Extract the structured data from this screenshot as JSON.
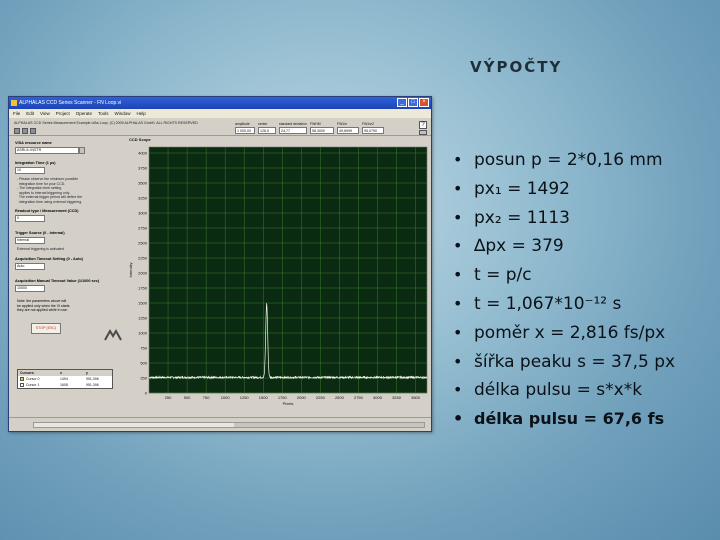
{
  "slide": {
    "title": "VÝPOČTY"
  },
  "window": {
    "title": "ALPHALAS CCD Series Scanner - FN Loop.vi",
    "menu": [
      "File",
      "Edit",
      "View",
      "Project",
      "Operate",
      "Tools",
      "Window",
      "Help"
    ],
    "copyright": "ALPHALAS CCD Series Measurement Example ofAs Loop. (C) 2009 ALPHALAS GmbH. ALL RIGHTS RESERVED",
    "readouts": [
      {
        "label": "amplitude",
        "value": "1 000,00"
      },
      {
        "label": "center",
        "value": "128,5"
      },
      {
        "label": "standard deviation",
        "value": "24,77"
      },
      {
        "label": "FWHM",
        "value": "58,3000"
      },
      {
        "label": "FW1/e",
        "value": "49,8999"
      },
      {
        "label": "FW1/e2",
        "value": "95,0790"
      }
    ],
    "plot_caption": "CCD Scope",
    "panel": {
      "resource_label": "VISA resource name",
      "resource_value": "ASRL5::INSTR",
      "integration_label": "Integration Time (1 µs)",
      "integration_value": "10",
      "integration_note": "- Please observe the minimum possible\n  integration time for your CCD.\n- The integration time setting\n  applies to internal triggering only.\n  The external trigger period will define the\n  integration time using external triggering.",
      "readout_label": "Readout type / Measurement (CCD)",
      "readout_value": "0",
      "trigger_label": "Trigger Source (0 - Internal)",
      "trigger_value": "Internal",
      "trigger_note": "External triggering is activated",
      "acq_label": "Acquisition Timeout Setting (0 - Auto)",
      "acq_value": "Auto",
      "timeout_label": "Acquisition Manual Timeout Value (1/1000 sec)",
      "timeout_value": "10000",
      "note": "Note: the parameters above will\nbe applied only when the VI starts\nthey are not applied while in use.",
      "stop_label": "STOP (ESC)",
      "cursor_table": {
        "headers": [
          "Cursors:",
          "x",
          "y"
        ],
        "rows": [
          {
            "name": "Cursor 0",
            "x": "1494",
            "y": "951,396"
          },
          {
            "name": "Cursor 1",
            "x": "1608",
            "y": "951,396"
          }
        ],
        "colors": [
          "#f2d21a",
          "#ffffff"
        ]
      }
    }
  },
  "chart_data": {
    "type": "line",
    "title": "",
    "xlabel": "Pixels",
    "ylabel": "Intensity",
    "xlim": [
      0,
      3650
    ],
    "ylim": [
      0,
      4100
    ],
    "x_ticks": [
      250,
      500,
      750,
      1000,
      1250,
      1500,
      1750,
      2000,
      2250,
      2500,
      2750,
      3000,
      3250,
      3500
    ],
    "y_ticks": [
      0,
      250,
      500,
      750,
      1000,
      1250,
      1500,
      1750,
      2000,
      2250,
      2500,
      2750,
      3000,
      3250,
      3500,
      3750,
      4000
    ],
    "baseline": 260,
    "peak": {
      "x": 1545,
      "y": 1490,
      "sigma": 6
    },
    "line_color": "#f3f7e8",
    "bg_color": "#0b2a12",
    "grid_color": "#3b7a2c",
    "grid": true
  },
  "bullets": [
    "posun p = 2*0,16 mm",
    "px₁ = 1492",
    "px₂ = 1113",
    "∆px = 379",
    "t = p/c",
    "t = 1,067*10⁻¹² s",
    "poměr x = 2,816 fs/px",
    "šířka peaku s = 37,5 px",
    "délka pulsu = s*x*k",
    "délka pulsu = 67,6 fs"
  ]
}
